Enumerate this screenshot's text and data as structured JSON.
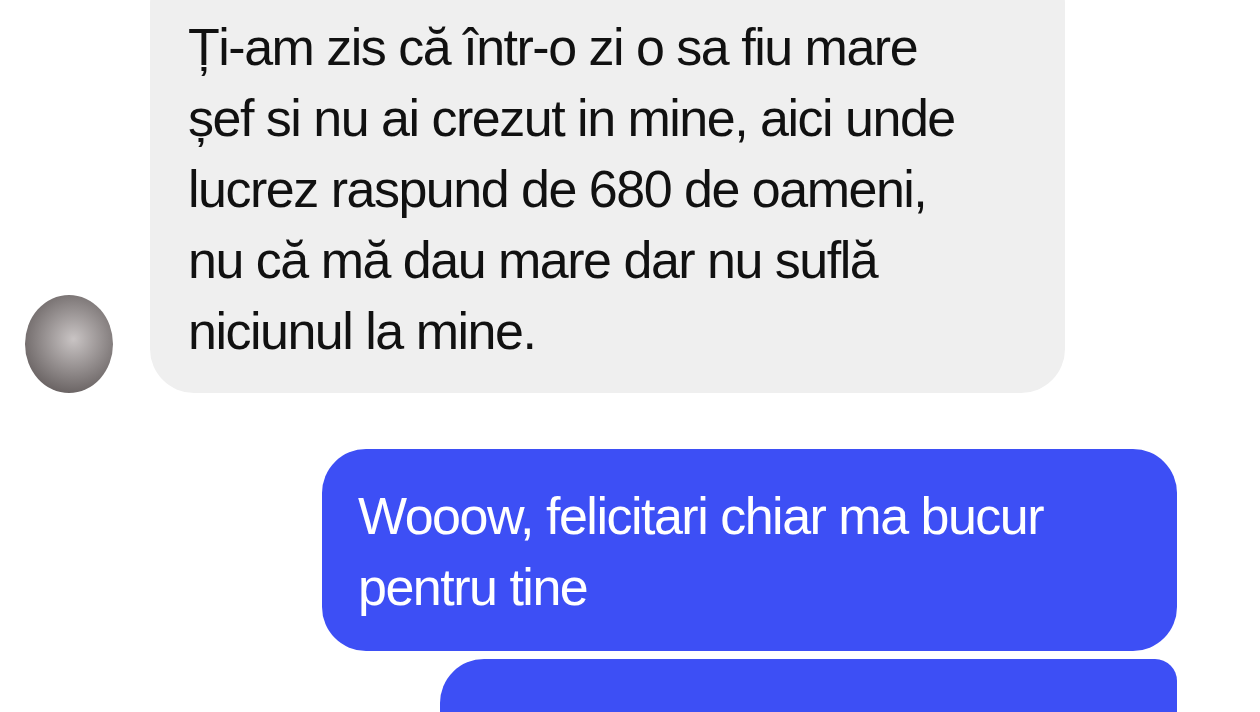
{
  "messages": [
    {
      "kind": "received",
      "lines": [
        "Ți-am zis că într-o zi o sa fiu mare",
        "șef si nu ai crezut in mine, aici unde",
        "lucrez raspund de 680 de oameni,",
        "nu că mă dau mare dar nu suflă",
        "niciunul la mine."
      ]
    },
    {
      "kind": "sent",
      "lines": [
        "Wooow, felicitari chiar ma bucur",
        "pentru tine"
      ]
    },
    {
      "kind": "sent"
    }
  ]
}
